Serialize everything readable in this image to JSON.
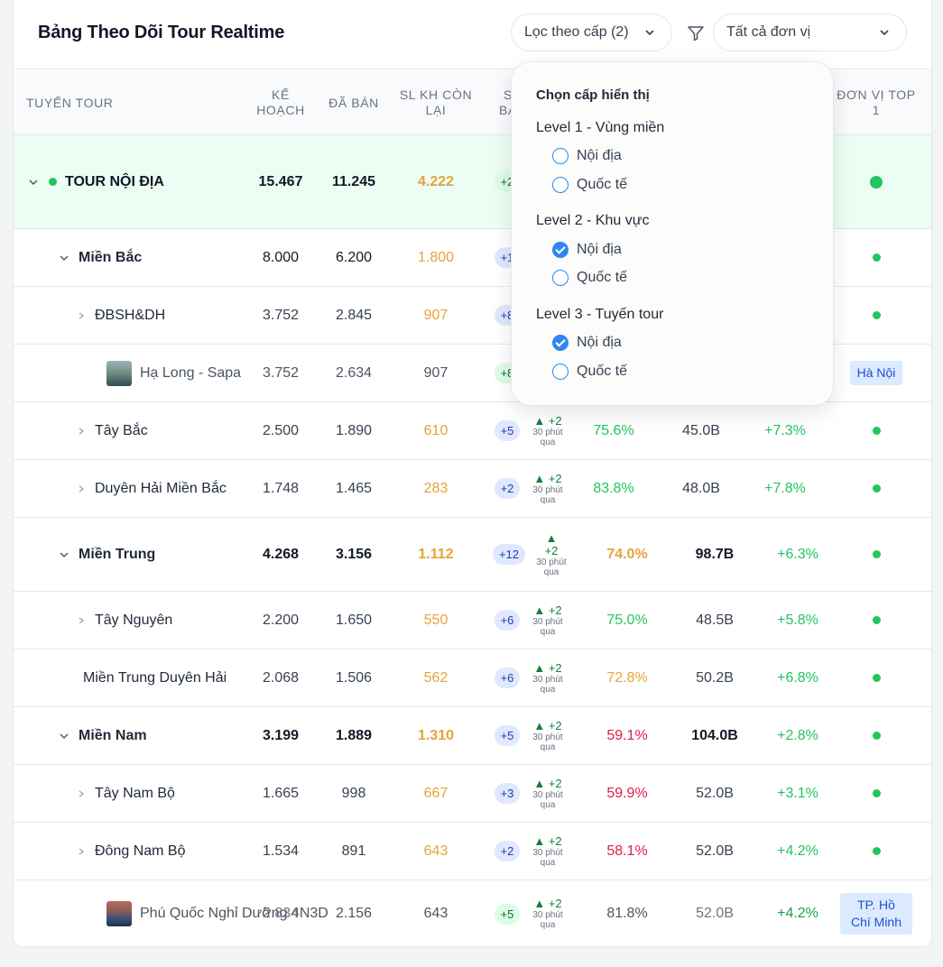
{
  "header": {
    "title": "Bảng Theo Dõi Tour Realtime",
    "level_filter_label": "Lọc theo cấp (2)",
    "unit_select_value": "Tất cả đơn vị"
  },
  "columns": {
    "route": "TUYẾN TOUR",
    "plan": "KẾ HOẠCH",
    "sold": "ĐÃ BÁN",
    "remaining": "SL KH CÒN LẠI",
    "sold_today": "S BÁ",
    "top_unit": "ĐƠN VỊ TOP 1"
  },
  "rows": [
    {
      "name": "TOUR NỘI ĐỊA",
      "plan": "15.467",
      "sold": "11.245",
      "remain": "4.222",
      "badge": "+2"
    },
    {
      "name": "Miền Bắc",
      "plan": "8.000",
      "sold": "6.200",
      "remain": "1.800",
      "badge": "+1"
    },
    {
      "name": "ĐBSH&DH",
      "plan": "3.752",
      "sold": "2.845",
      "remain": "907",
      "badge": "+8"
    },
    {
      "name": "Hạ Long - Sapa",
      "plan": "3.752",
      "sold": "2.634",
      "remain": "907",
      "badge": "+8",
      "top_unit": "Hà Nội"
    },
    {
      "name": "Tây Bắc",
      "plan": "2.500",
      "sold": "1.890",
      "remain": "610",
      "badge": "+5",
      "trend": "▲ +2",
      "trend_time": "30 phút qua",
      "rate": "75.6%",
      "revenue": "45.0B",
      "growth": "+7.3%"
    },
    {
      "name": "Duyên Hải Miền Bắc",
      "plan": "1.748",
      "sold": "1.465",
      "remain": "283",
      "badge": "+2",
      "trend": "▲ +2",
      "trend_time": "30 phút qua",
      "rate": "83.8%",
      "revenue": "48.0B",
      "growth": "+7.8%"
    },
    {
      "name": "Miền Trung",
      "plan": "4.268",
      "sold": "3.156",
      "remain": "1.112",
      "badge": "+12",
      "trend_arrow": "▲",
      "trend_value": "+2",
      "trend_time1": "30 phút",
      "trend_time2": "qua",
      "rate": "74.0%",
      "revenue": "98.7B",
      "growth": "+6.3%"
    },
    {
      "name": "Tây Nguyên",
      "plan": "2.200",
      "sold": "1.650",
      "remain": "550",
      "badge": "+6",
      "trend": "▲ +2",
      "trend_time": "30 phút qua",
      "rate": "75.0%",
      "revenue": "48.5B",
      "growth": "+5.8%"
    },
    {
      "name": "Miền Trung Duyên Hải",
      "plan": "2.068",
      "sold": "1.506",
      "remain": "562",
      "badge": "+6",
      "trend": "▲ +2",
      "trend_time": "30 phút qua",
      "rate": "72.8%",
      "revenue": "50.2B",
      "growth": "+6.8%"
    },
    {
      "name": "Miền Nam",
      "plan": "3.199",
      "sold": "1.889",
      "remain": "1.310",
      "badge": "+5",
      "trend": "▲ +2",
      "trend_time": "30 phút qua",
      "rate": "59.1%",
      "revenue": "104.0B",
      "growth": "+2.8%"
    },
    {
      "name": "Tây Nam Bộ",
      "plan": "1.665",
      "sold": "998",
      "remain": "667",
      "badge": "+3",
      "trend": "▲ +2",
      "trend_time": "30 phút qua",
      "rate": "59.9%",
      "revenue": "52.0B",
      "growth": "+3.1%"
    },
    {
      "name": "Đông Nam Bộ",
      "plan": "1.534",
      "sold": "891",
      "remain": "643",
      "badge": "+2",
      "trend": "▲ +2",
      "trend_time": "30 phút qua",
      "rate": "58.1%",
      "revenue": "52.0B",
      "growth": "+4.2%"
    },
    {
      "name": "Phú Quốc Nghỉ Dưỡng 4N3D",
      "plan": "2.834",
      "sold": "2.156",
      "remain": "643",
      "badge": "+5",
      "trend": "▲ +2",
      "trend_time": "30 phút qua",
      "rate": "81.8%",
      "revenue": "52.0B",
      "growth": "+4.2%",
      "top_unit": "TP. Hồ Chí Minh"
    }
  ],
  "dropdown": {
    "title": "Chọn cấp hiển thị",
    "levels": [
      {
        "label": "Level 1 - Vùng miền",
        "options": [
          {
            "label": "Nội địa",
            "checked": false
          },
          {
            "label": "Quốc tế",
            "checked": false
          }
        ]
      },
      {
        "label": "Level 2 - Khu vực",
        "options": [
          {
            "label": "Nội địa",
            "checked": true
          },
          {
            "label": "Quốc tế",
            "checked": false
          }
        ]
      },
      {
        "label": "Level 3 - Tuyến tour",
        "options": [
          {
            "label": "Nội địa",
            "checked": true
          },
          {
            "label": "Quốc tế",
            "checked": false
          }
        ]
      }
    ]
  },
  "colors": {
    "accent": "#2f86f0",
    "positive": "#22c55e",
    "warning": "#e6a23c",
    "negative": "#e11d48",
    "level0_bg": "#ecfdf3"
  }
}
